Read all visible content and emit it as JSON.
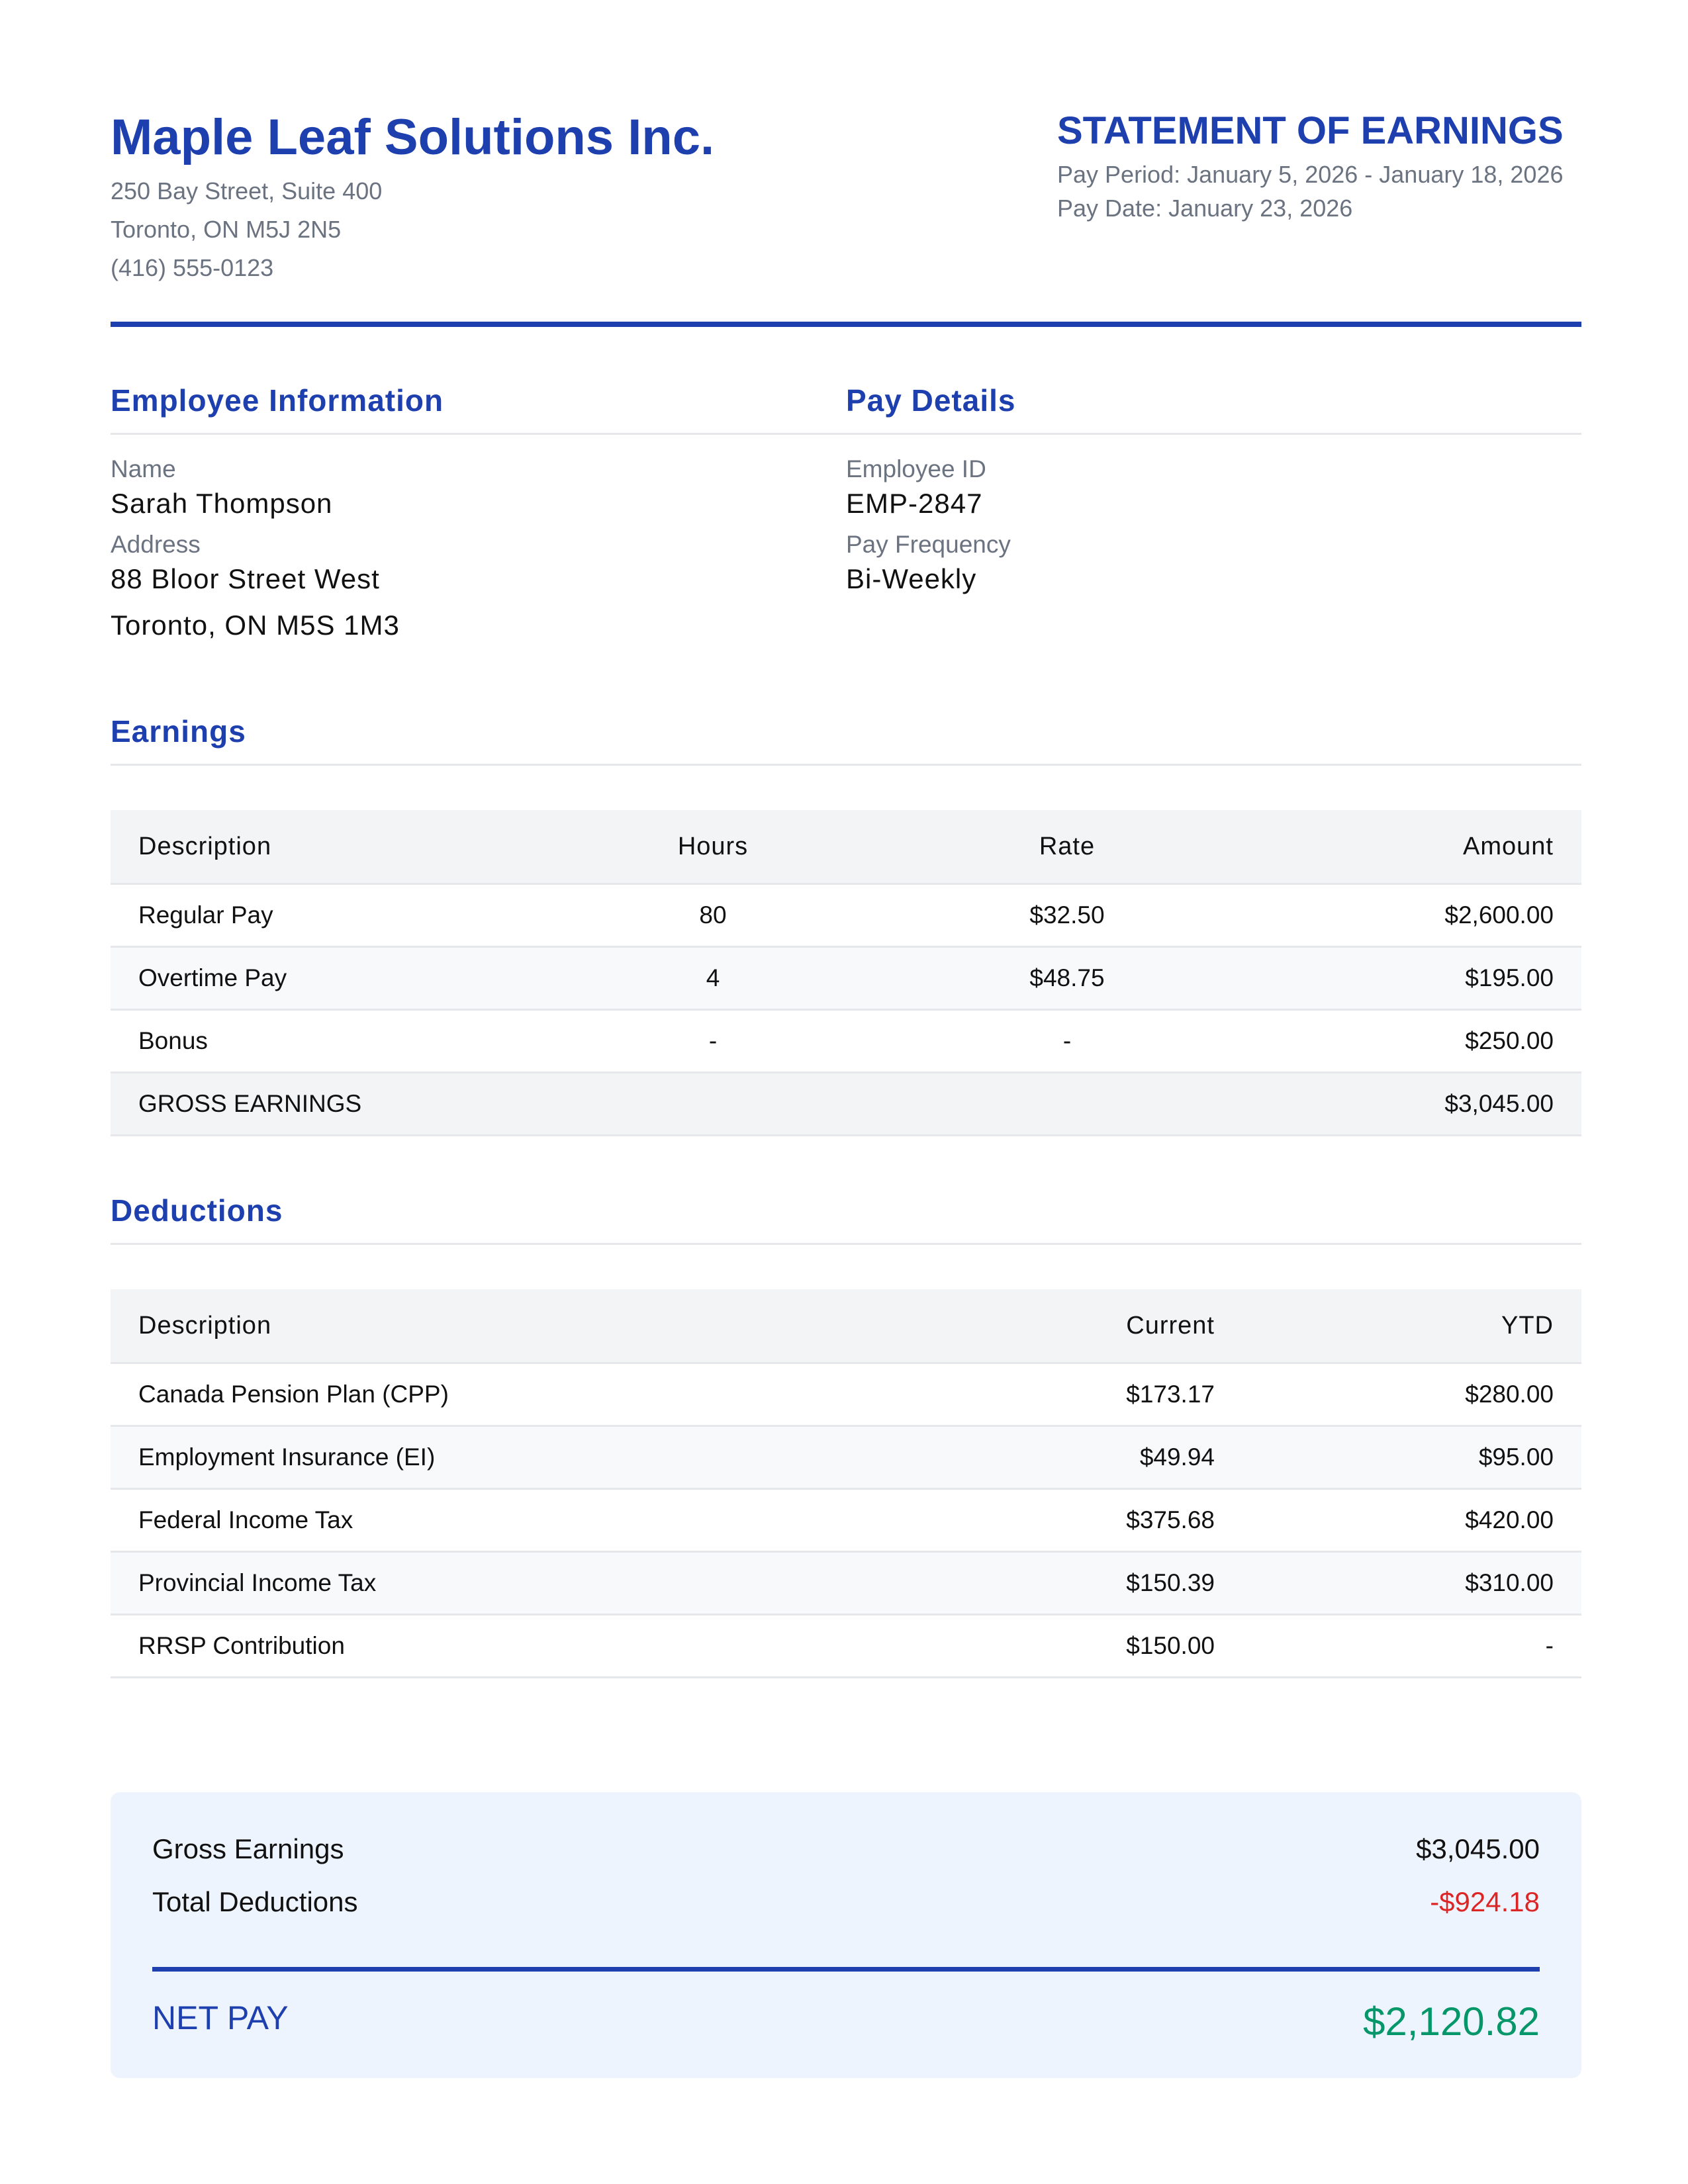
{
  "company": {
    "name": "Maple Leaf Solutions Inc.",
    "address_line1": "250 Bay Street, Suite 400",
    "address_line2": "Toronto, ON M5J 2N5",
    "phone": "(416) 555-0123"
  },
  "statement": {
    "title": "STATEMENT OF EARNINGS",
    "pay_period": "Pay Period: January 5, 2026 - January 18, 2026",
    "pay_date": "Pay Date: January 23, 2026"
  },
  "employee_info": {
    "heading": "Employee Information",
    "name_label": "Name",
    "name": "Sarah Thompson",
    "address_label": "Address",
    "address_line1": "88 Bloor Street West",
    "address_line2": "Toronto, ON M5S 1M3"
  },
  "pay_details": {
    "heading": "Pay Details",
    "employee_id_label": "Employee ID",
    "employee_id": "EMP-2847",
    "frequency_label": "Pay Frequency",
    "frequency": "Bi-Weekly"
  },
  "earnings": {
    "heading": "Earnings",
    "columns": [
      "Description",
      "Hours",
      "Rate",
      "Amount"
    ],
    "rows": [
      [
        "Regular Pay",
        "80",
        "$32.50",
        "$2,600.00"
      ],
      [
        "Overtime Pay",
        "4",
        "$48.75",
        "$195.00"
      ],
      [
        "Bonus",
        "-",
        "-",
        "$250.00"
      ]
    ],
    "total_label": "GROSS EARNINGS",
    "total_amount": "$3,045.00"
  },
  "deductions": {
    "heading": "Deductions",
    "columns": [
      "Description",
      "Current",
      "YTD"
    ],
    "rows": [
      [
        "Canada Pension Plan (CPP)",
        "$173.17",
        "$280.00"
      ],
      [
        "Employment Insurance (EI)",
        "$49.94",
        "$95.00"
      ],
      [
        "Federal Income Tax",
        "$375.68",
        "$420.00"
      ],
      [
        "Provincial Income Tax",
        "$150.39",
        "$310.00"
      ],
      [
        "RRSP Contribution",
        "$150.00",
        "-"
      ]
    ]
  },
  "summary": {
    "gross_label": "Gross Earnings",
    "gross_value": "$3,045.00",
    "deductions_label": "Total Deductions",
    "deductions_value": "-$924.18",
    "net_label": "NET PAY",
    "net_value": "$2,120.82"
  },
  "colors": {
    "accent": "#1e3fae",
    "negative": "#dc2626",
    "positive": "#059669",
    "summary_bg": "#eef4fd"
  }
}
